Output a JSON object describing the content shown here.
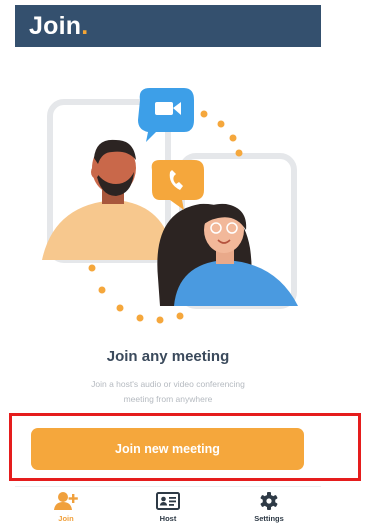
{
  "header": {
    "logo_text": "Join",
    "logo_dot": "."
  },
  "main": {
    "title": "Join any meeting",
    "subtitle_line1": "Join a host's audio or video conferencing",
    "subtitle_line2": "meeting from anywhere",
    "button_label": "Join new meeting"
  },
  "nav": {
    "items": [
      {
        "label": "Join",
        "icon": "add-user-icon",
        "active": true
      },
      {
        "label": "Host",
        "icon": "id-card-icon",
        "active": false
      },
      {
        "label": "Settings",
        "icon": "gear-icon",
        "active": false
      }
    ]
  },
  "colors": {
    "header_bg": "#34506e",
    "accent": "#f5a73c",
    "highlight": "#e51d1d",
    "bubble_blue": "#3d9fe8"
  }
}
